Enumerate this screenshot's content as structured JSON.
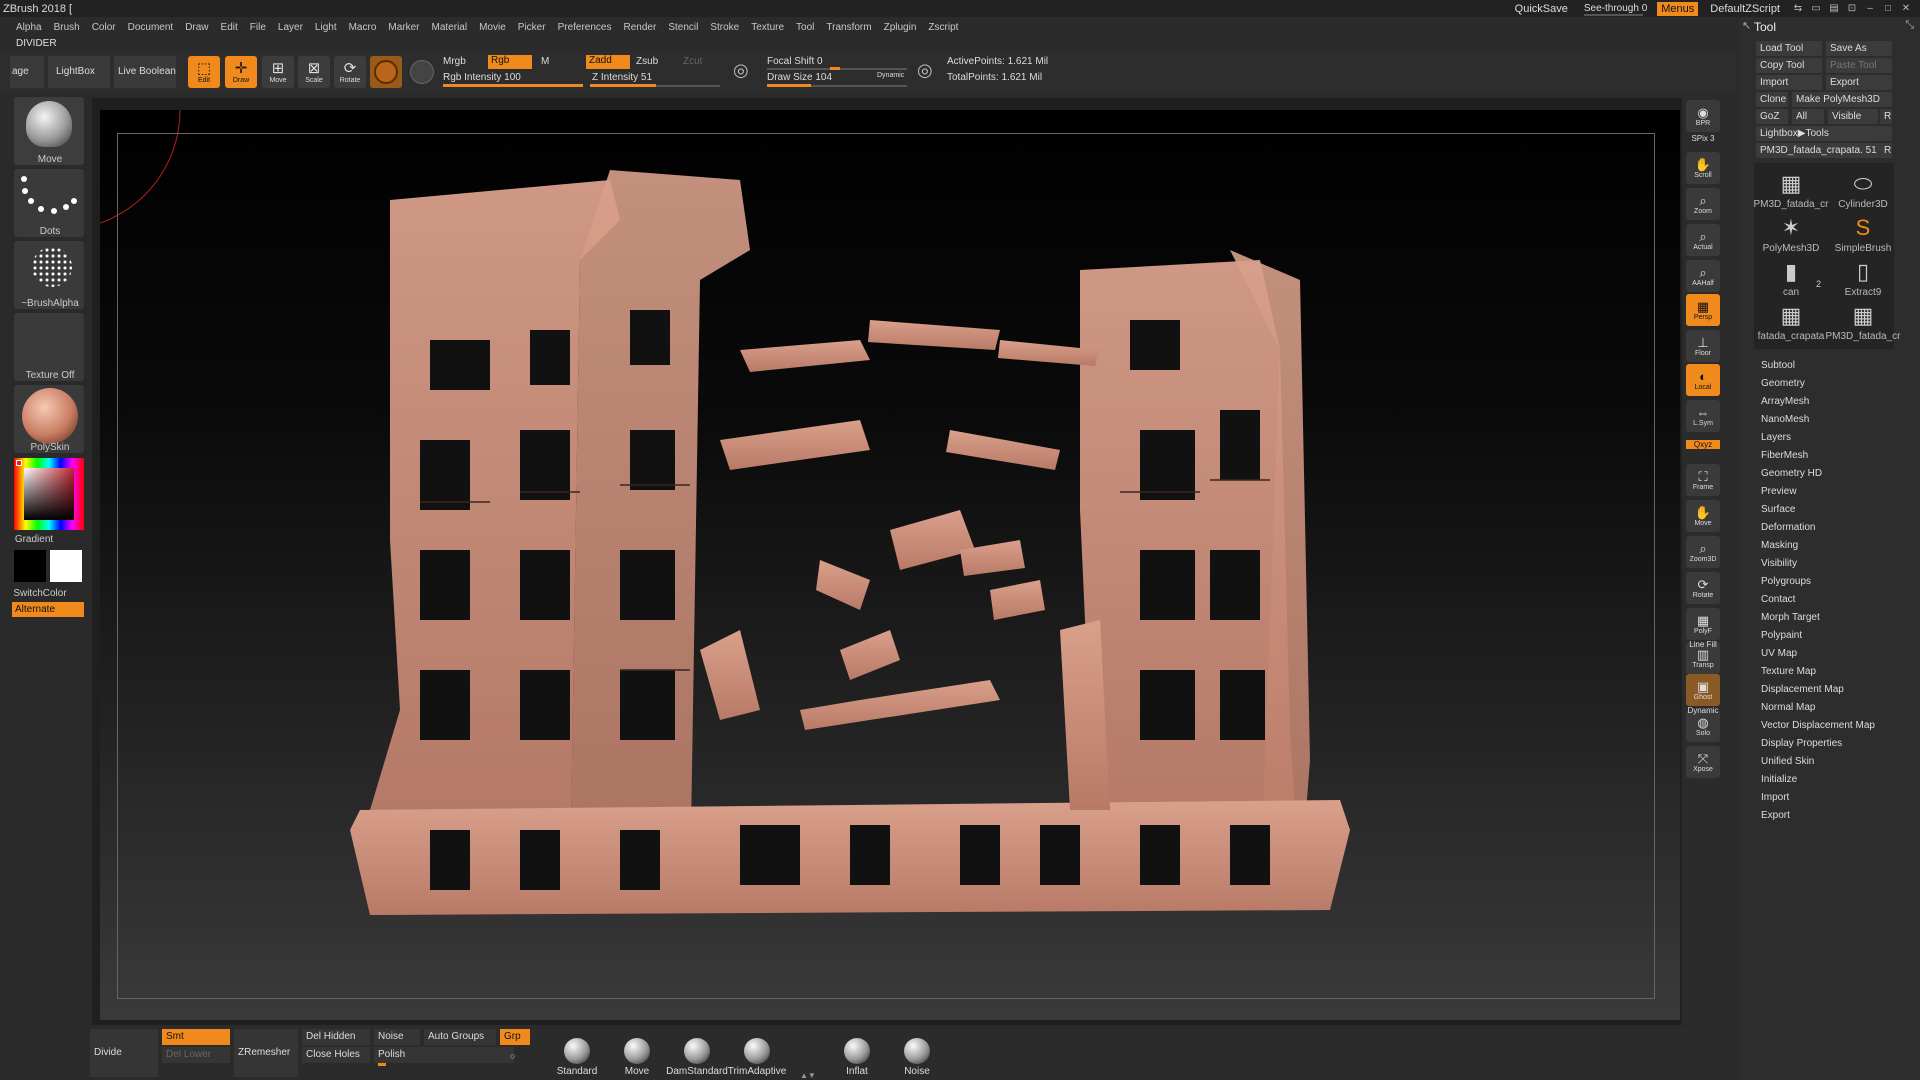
{
  "titlebar": {
    "app_title": "ZBrush 2018 [",
    "quicksave": "QuickSave",
    "see_through": "See-through 0",
    "menus": "Menus",
    "default_zscript": "DefaultZScript"
  },
  "menubar": {
    "items": [
      "Alpha",
      "Brush",
      "Color",
      "Document",
      "Draw",
      "Edit",
      "File",
      "Layer",
      "Light",
      "Macro",
      "Marker",
      "Material",
      "Movie",
      "Picker",
      "Preferences",
      "Render",
      "Stencil",
      "Stroke",
      "Texture",
      "Tool",
      "Transform",
      "Zplugin",
      "Zscript"
    ]
  },
  "divider_label": "DIVIDER",
  "toolbar": {
    "age_label": "age",
    "lightbox": "LightBox",
    "live_boolean": "Live Boolean",
    "edit": "Edit",
    "draw": "Draw",
    "move": "Move",
    "scale": "Scale",
    "rotate": "Rotate",
    "mrgb": "Mrgb",
    "rgb": "Rgb",
    "m": "M",
    "rgb_intensity": "Rgb Intensity 100",
    "zadd": "Zadd",
    "zsub": "Zsub",
    "zcut": "Zcut",
    "z_intensity": "Z Intensity 51",
    "focal_shift": "Focal Shift 0",
    "draw_size": "Draw Size 104",
    "dynamic": "Dynamic",
    "active_points": "ActivePoints: 1.621 Mil",
    "total_points": "TotalPoints: 1.621 Mil",
    "rgb_intensity_value": 100,
    "z_intensity_value": 51,
    "draw_size_value": 104
  },
  "lefttray": {
    "move": "Move",
    "dots": "Dots",
    "brush_alpha": "~BrushAlpha",
    "texture_off": "Texture Off",
    "polyskin": "PolySkin",
    "gradient": "Gradient",
    "switch_color": "SwitchColor",
    "alternate": "Alternate"
  },
  "rightshelf": {
    "buttons": [
      {
        "label": "BPR"
      },
      {
        "label": "Scroll"
      },
      {
        "label": "Zoom"
      },
      {
        "label": "Actual"
      },
      {
        "label": "AAHalf"
      },
      {
        "label": "Persp"
      },
      {
        "label": "Floor"
      },
      {
        "label": "Local"
      },
      {
        "label": "L.Sym"
      },
      {
        "label": "Frame"
      },
      {
        "label": "Move"
      },
      {
        "label": "Zoom3D"
      },
      {
        "label": "Rotate"
      },
      {
        "label": "PolyF"
      },
      {
        "label": "Transp"
      },
      {
        "label": "Ghost"
      },
      {
        "label": "Solo"
      },
      {
        "label": "Xpose"
      }
    ],
    "spix": "SPix 3",
    "xyz": "Qxyz",
    "line_fill": "Line Fill",
    "dynamic": "Dynamic"
  },
  "toolpanel": {
    "title": "Tool",
    "load_tool": "Load Tool",
    "save_as": "Save As",
    "copy_tool": "Copy Tool",
    "paste_tool": "Paste Tool",
    "import": "Import",
    "export": "Export",
    "clone": "Clone",
    "make_polymesh": "Make PolyMesh3D",
    "goz": "GoZ",
    "all": "All",
    "visible": "Visible",
    "r": "R",
    "lightbox_tools": "Lightbox▶Tools",
    "current_tool": "PM3D_fatada_crapata. 51",
    "thumbs": [
      {
        "label": "PM3D_fatada_cr"
      },
      {
        "label": "Cylinder3D"
      },
      {
        "label": "PolyMesh3D"
      },
      {
        "label": "SimpleBrush"
      },
      {
        "label": "can"
      },
      {
        "label": "Extract9"
      },
      {
        "label": "fatada_crapata"
      },
      {
        "label": "PM3D_fatada_cr"
      }
    ],
    "extract_count": "2",
    "submenus": [
      "Subtool",
      "Geometry",
      "ArrayMesh",
      "NanoMesh",
      "Layers",
      "FiberMesh",
      "Geometry HD",
      "Preview",
      "Surface",
      "Deformation",
      "Masking",
      "Visibility",
      "Polygroups",
      "Contact",
      "Morph Target",
      "Polypaint",
      "UV Map",
      "Texture Map",
      "Displacement Map",
      "Normal Map",
      "Vector Displacement Map",
      "Display Properties",
      "Unified Skin",
      "Initialize",
      "Import",
      "Export"
    ]
  },
  "bottombar": {
    "divide": "Divide",
    "smt": "Smt",
    "del_lower": "Del Lower",
    "zremesher": "ZRemesher",
    "del_hidden": "Del Hidden",
    "close_holes": "Close Holes",
    "noise": "Noise",
    "auto_groups": "Auto Groups",
    "grp": "Grp",
    "polish": "Polish",
    "brushes": [
      "Standard",
      "Move",
      "DamStandard",
      "TrimAdaptive",
      "Inflat",
      "Noise"
    ]
  },
  "colors": {
    "accent": "#f08a1c",
    "model": "#c98a78",
    "bg": "#2a2a2a"
  }
}
